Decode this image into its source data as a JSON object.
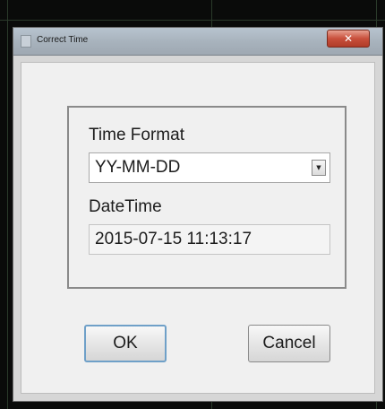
{
  "window": {
    "title": "Correct Time",
    "close_glyph": "✕"
  },
  "group": {
    "time_format_label": "Time Format",
    "time_format_value": "YY-MM-DD",
    "datetime_label": "DateTime",
    "datetime_value": "2015-07-15 11:13:17"
  },
  "buttons": {
    "ok": "OK",
    "cancel": "Cancel"
  },
  "icons": {
    "window_icon": "window-icon",
    "close": "close-icon",
    "dropdown": "chevron-down-icon"
  },
  "colors": {
    "close_button": "#c8503c",
    "default_button_border": "#6fa0c8",
    "background_grid": "#2a3a2a"
  }
}
